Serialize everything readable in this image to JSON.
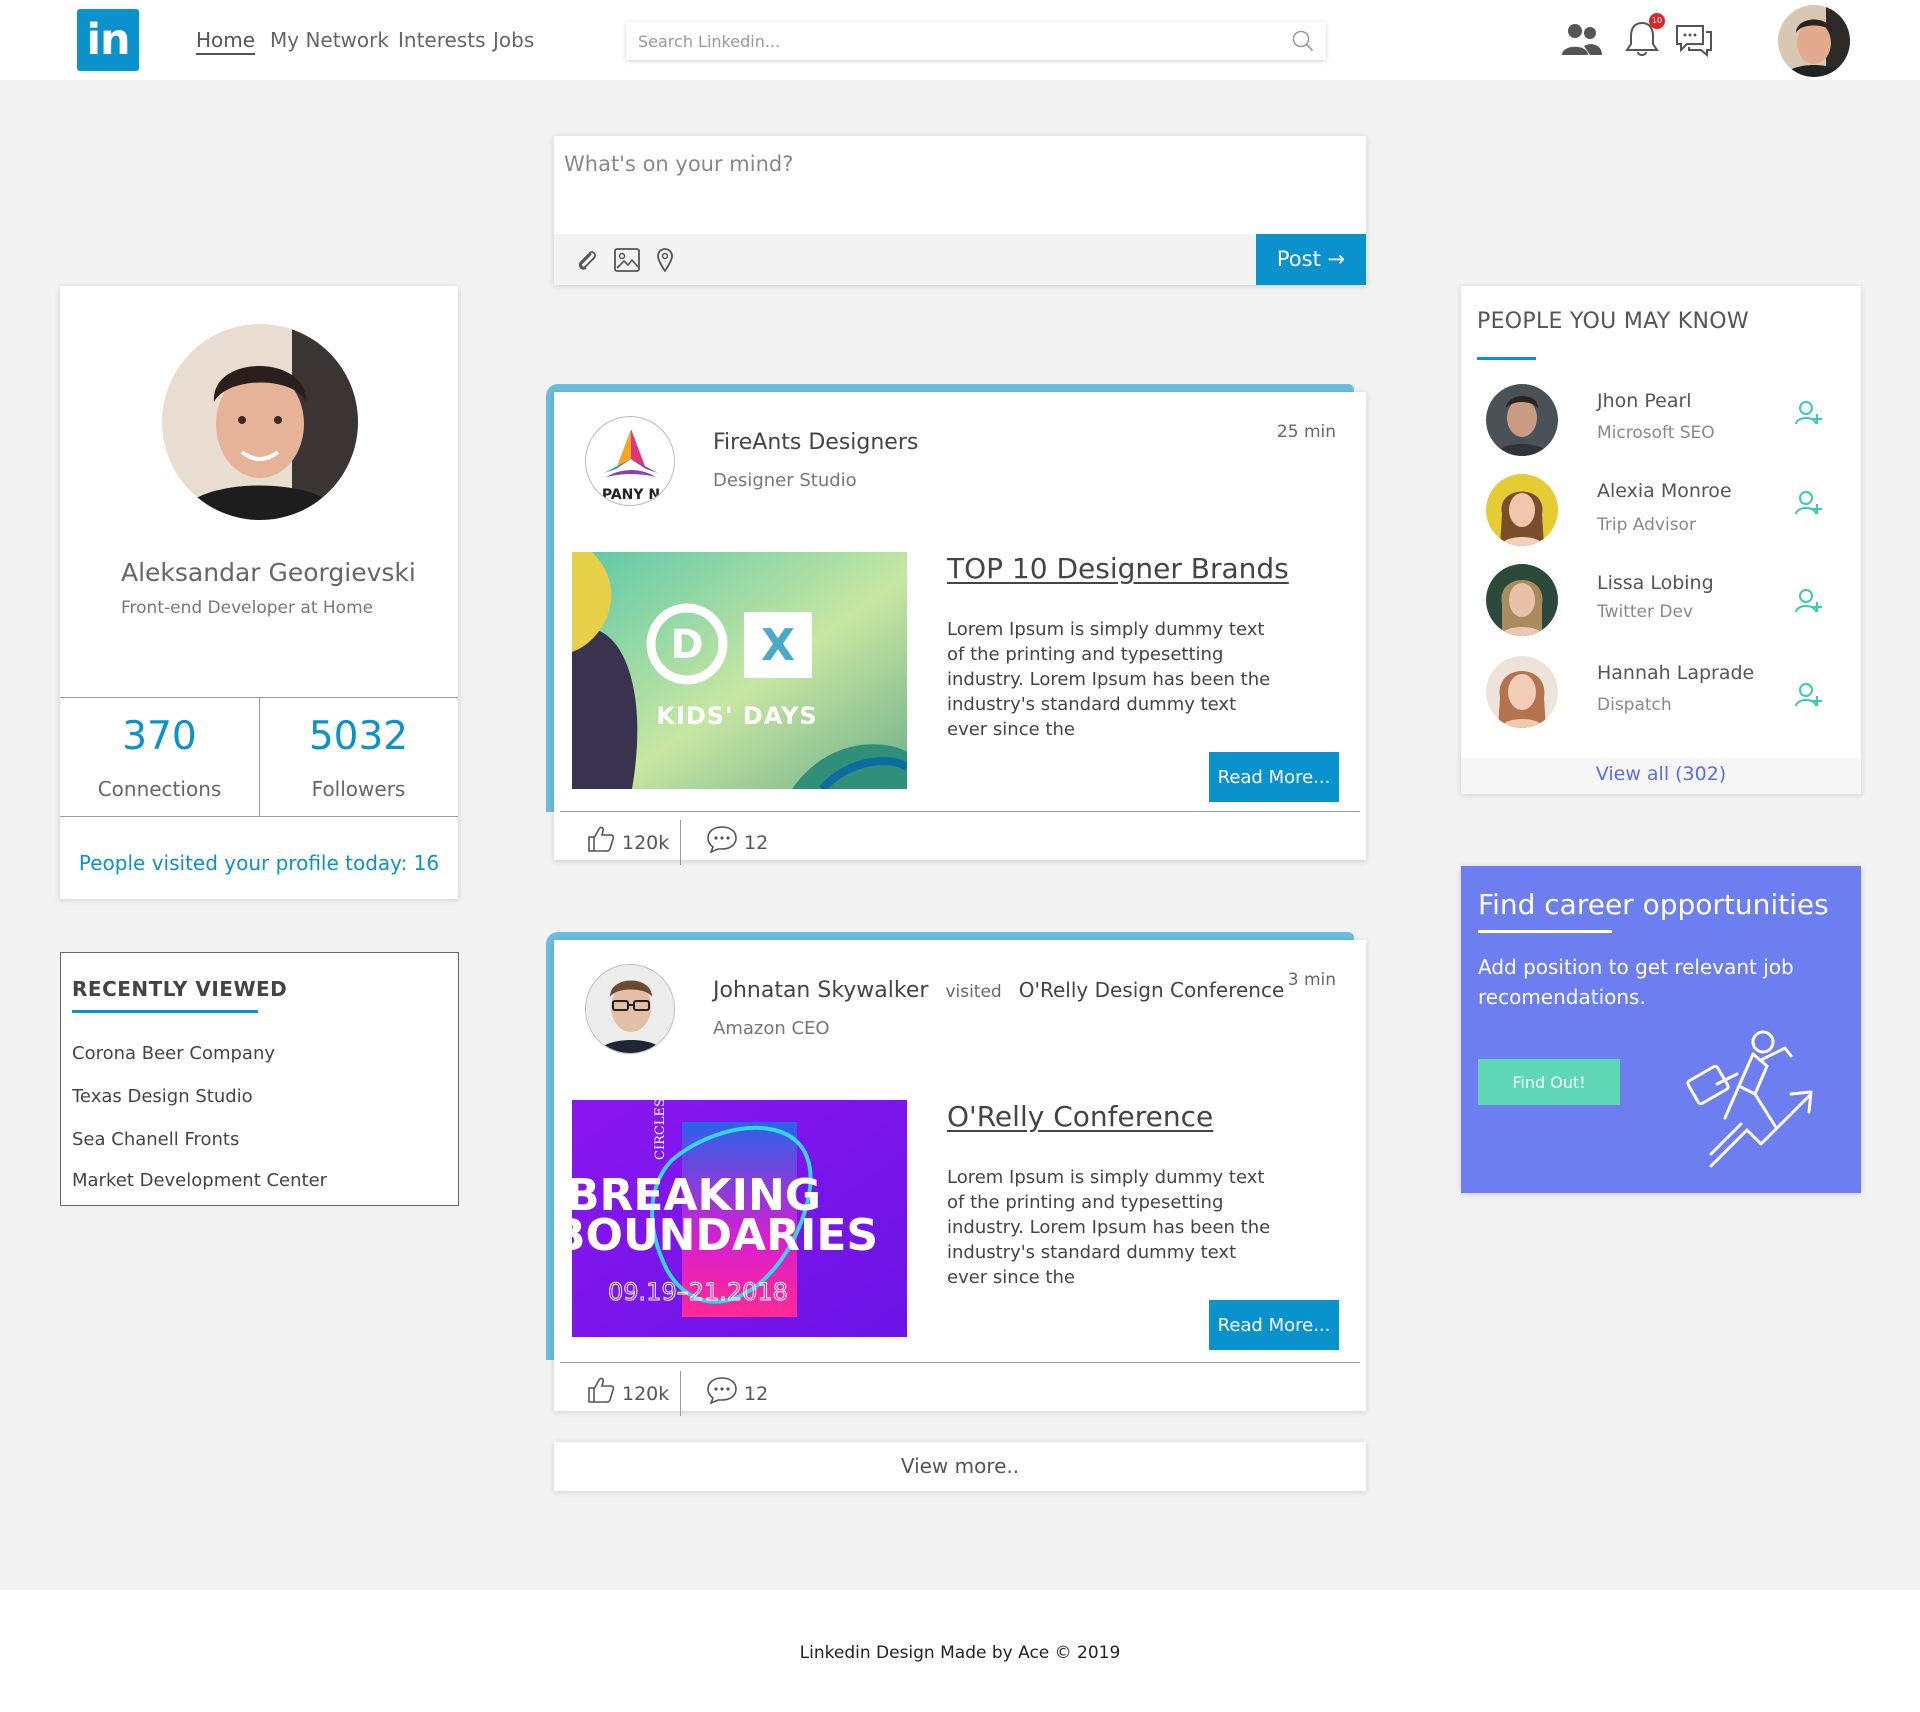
{
  "header": {
    "logo": "in",
    "nav": [
      "Home",
      "My Network",
      "Interests",
      "Jobs"
    ],
    "search_placeholder": "Search Linkedin...",
    "notification_count": "10",
    "icons": [
      "people-icon",
      "bell-icon",
      "chat-icon",
      "search-icon"
    ]
  },
  "profile": {
    "name": "Aleksandar Georgievski",
    "title": "Front-end Developer at Home",
    "connections_count": "370",
    "connections_label": "Connections",
    "followers_count": "5032",
    "followers_label": "Followers",
    "visits": "People visited your profile today: 16"
  },
  "recent": {
    "heading": "RECENTLY VIEWED",
    "items": [
      "Corona Beer Company",
      "Texas Design Studio",
      "Sea Chanell Fronts",
      "Market Development Center"
    ]
  },
  "composer": {
    "placeholder": "What's on your mind?",
    "post_label": "Post →"
  },
  "posts": [
    {
      "author": "FireAnts Designers",
      "subtitle": "Designer Studio",
      "time": "25 min",
      "logo_text": "PANY N",
      "image_text": [
        "KIDS' DAYS"
      ],
      "headline": "TOP 10 Designer Brands",
      "body": "Lorem Ipsum is simply dummy text of the printing and typesetting industry. Lorem Ipsum has been the industry's standard dummy text ever since the",
      "read_more": "Read More...",
      "likes": "120k",
      "comments": "12"
    },
    {
      "author": "Johnatan Skywalker",
      "visited": "visited",
      "target": "O'Relly Design Conference",
      "subtitle": "Amazon CEO",
      "time": "3 min",
      "image_text": [
        "CIRCLES",
        "BREAKING",
        "BOUNDARIES",
        "09.19–21.2018"
      ],
      "headline": "O'Relly Conference ",
      "body": "Lorem Ipsum is simply dummy text of the printing and typesetting industry. Lorem Ipsum has been the industry's standard dummy text ever since the",
      "read_more": "Read More...",
      "likes": "120k",
      "comments": "12"
    }
  ],
  "view_more": "View more..",
  "people": {
    "heading": "PEOPLE YOU MAY KNOW",
    "list": [
      {
        "name": "Jhon Pearl",
        "role": "Microsoft SEO"
      },
      {
        "name": "Alexia Monroe",
        "role": "Trip Advisor"
      },
      {
        "name": "Lissa Lobing",
        "role": "Twitter Dev"
      },
      {
        "name": "Hannah Laprade",
        "role": "Dispatch"
      }
    ],
    "view_all": "View all (302)"
  },
  "career": {
    "heading": "Find career opportunities",
    "description": "Add position to get relevant job recomendations.",
    "button": "Find Out!"
  },
  "footer": {
    "text": "Linkedin Design Made by Ace © 2019"
  },
  "colors": {
    "brand": "#0a92cc",
    "accent_bar": "#6bbde0",
    "career_bg": "#6c7ef0",
    "career_button": "#5ed7b6",
    "add_person_icon": "#3cc7b6"
  }
}
